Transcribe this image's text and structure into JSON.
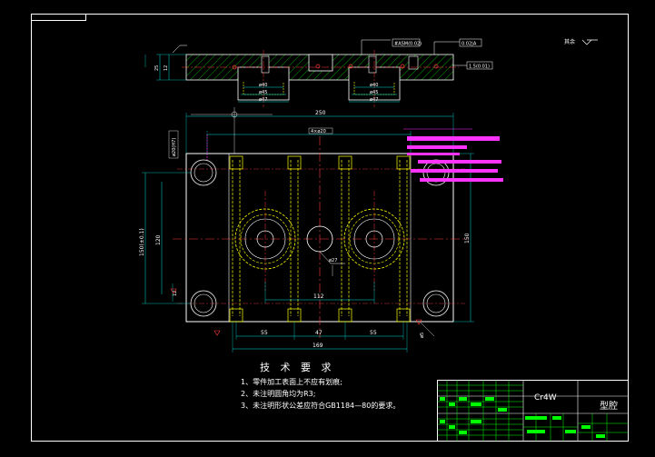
{
  "drawing": {
    "colors": {
      "background": "#000000",
      "frame": "#ffffff",
      "outline": "#ffffff",
      "hidden": "#ffff00",
      "center": "#ff3b3b",
      "dimension": "#00e0e0",
      "hatch": "#00cc00",
      "highlight": "#ff33ff",
      "titleblock": "#00ff00"
    },
    "roughness_note": "其余",
    "section_view": {
      "tolerance_labels": [
        "#ASM(0.02)",
        "0.02|A",
        "1.5(0.01)"
      ],
      "bore_dims": [
        "ø40",
        "ø45",
        "ø47"
      ],
      "height_dims": [
        "25",
        "12"
      ]
    },
    "plan_view": {
      "overall_width": "250",
      "overall_height": "120",
      "side_height": "150",
      "left_height": "150(±0.1)",
      "bottom_left": "55",
      "bottom_mid": "47",
      "bottom_right": "55",
      "bottom_overall": "169",
      "center_span": "112",
      "hole_label": "ø27",
      "top_hole_label": "4×ø20",
      "pad_label": "ø20(H7)",
      "left_small": "12",
      "bottom_small": "ø5"
    },
    "tech": {
      "title": "技 术 要 求",
      "lines": [
        "1、零件加工表面上不应有划痕;",
        "2、未注明圆角均为R3;",
        "3、未注明形状公差应符合GB1184—80的要求。"
      ]
    },
    "titleblock": {
      "material": "Cr4W",
      "part_name": "型腔"
    }
  }
}
